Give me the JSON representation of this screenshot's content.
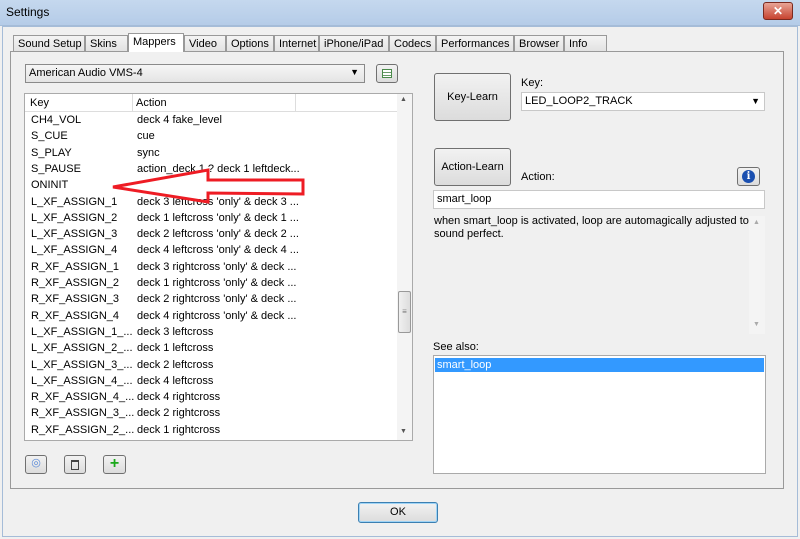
{
  "window": {
    "title": "Settings",
    "close_label": "✕"
  },
  "tabs": [
    "Sound Setup",
    "Skins",
    "Mappers",
    "Video",
    "Options",
    "Internet",
    "iPhone/iPad",
    "Codecs",
    "Performances",
    "Browser",
    "Info"
  ],
  "active_tab": "Mappers",
  "mapper": {
    "selected": "American Audio VMS-4"
  },
  "list": {
    "headers": {
      "key": "Key",
      "action": "Action"
    },
    "rows": [
      {
        "key": "CH4_VOL",
        "action": "deck 4 fake_level"
      },
      {
        "key": "S_CUE",
        "action": "cue"
      },
      {
        "key": "S_PLAY",
        "action": "sync"
      },
      {
        "key": "S_PAUSE",
        "action": "action_deck 1 ? deck 1 leftdeck..."
      },
      {
        "key": "ONINIT",
        "action": ""
      },
      {
        "key": "L_XF_ASSIGN_1",
        "action": "deck 3 leftcross 'only' & deck 3 ..."
      },
      {
        "key": "L_XF_ASSIGN_2",
        "action": "deck 1 leftcross 'only' & deck 1 ..."
      },
      {
        "key": "L_XF_ASSIGN_3",
        "action": "deck 2 leftcross 'only' & deck 2 ..."
      },
      {
        "key": "L_XF_ASSIGN_4",
        "action": "deck 4 leftcross 'only' & deck 4 ..."
      },
      {
        "key": "R_XF_ASSIGN_1",
        "action": "deck 3 rightcross 'only' & deck ..."
      },
      {
        "key": "R_XF_ASSIGN_2",
        "action": "deck 1 rightcross 'only' & deck ..."
      },
      {
        "key": "R_XF_ASSIGN_3",
        "action": "deck 2 rightcross 'only' & deck ..."
      },
      {
        "key": "R_XF_ASSIGN_4",
        "action": "deck 4 rightcross 'only' & deck ..."
      },
      {
        "key": "L_XF_ASSIGN_1_...",
        "action": "deck 3 leftcross"
      },
      {
        "key": "L_XF_ASSIGN_2_...",
        "action": "deck 1 leftcross"
      },
      {
        "key": "L_XF_ASSIGN_3_...",
        "action": "deck 2 leftcross"
      },
      {
        "key": "L_XF_ASSIGN_4_...",
        "action": "deck 4 leftcross"
      },
      {
        "key": "R_XF_ASSIGN_4_...",
        "action": "deck 4 rightcross"
      },
      {
        "key": "R_XF_ASSIGN_3_...",
        "action": "deck 2 rightcross"
      },
      {
        "key": "R_XF_ASSIGN_2_...",
        "action": "deck 1 rightcross"
      }
    ]
  },
  "right": {
    "key_learn": "Key-Learn",
    "key_label": "Key:",
    "key_value": "LED_LOOP2_TRACK",
    "action_learn": "Action-Learn",
    "action_label": "Action:",
    "action_value": "smart_loop",
    "description": "when smart_loop is activated, loop are automagically adjusted to sound perfect.",
    "see_also_label": "See also:",
    "see_also": [
      "smart_loop"
    ]
  },
  "ok_label": "OK",
  "colors": {
    "arrow": "#ee1c24",
    "selection": "#3399ff"
  }
}
